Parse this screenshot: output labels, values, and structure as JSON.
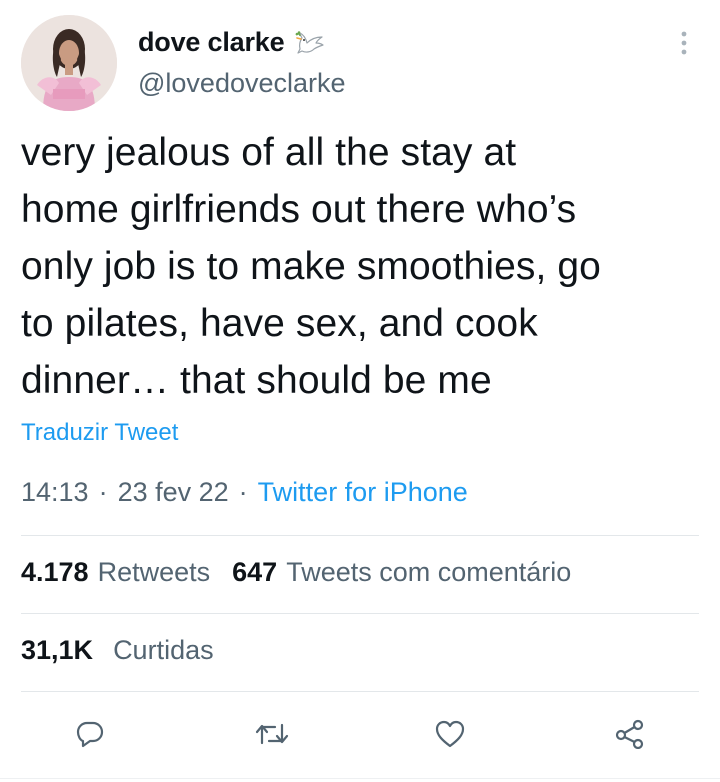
{
  "author": {
    "display_name": "dove clarke",
    "handle": "@lovedoveclarke",
    "name_emoji": "dove-icon"
  },
  "tweet": {
    "text": "very jealous of all the stay at\nhome girlfriends out there who’s\nonly job is to make smoothies, go\nto pilates, have sex, and cook\ndinner… that should be me",
    "translate_label": "Traduzir Tweet",
    "time": "14:13",
    "date": "23 fev 22",
    "separator": "·",
    "source": "Twitter for iPhone"
  },
  "stats": {
    "retweets_count": "4.178",
    "retweets_label": "Retweets",
    "quotes_count": "647",
    "quotes_label": "Tweets com comentário",
    "likes_count": "31,1K",
    "likes_label": "Curtidas"
  },
  "actions": [
    "reply-icon",
    "retweet-icon",
    "like-icon",
    "share-icon"
  ],
  "colors": {
    "text": "#0f1419",
    "secondary": "#536471",
    "link": "#1d9bf0",
    "divider": "#e3e7ea"
  }
}
